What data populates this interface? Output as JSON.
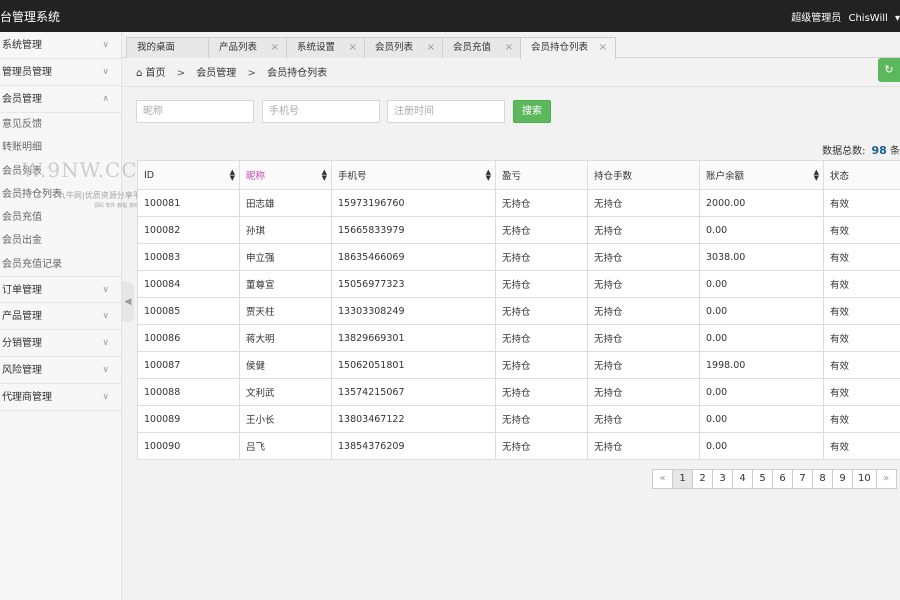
{
  "app": {
    "title": "台管理系统"
  },
  "user": {
    "role": "超级管理员",
    "name": "ChisWill",
    "caret": "▾"
  },
  "sidebar": {
    "items": [
      {
        "label": "系统管理",
        "icon": "chevron-down"
      },
      {
        "label": "管理员管理",
        "icon": "chevron-down"
      },
      {
        "label": "会员管理",
        "icon": "chevron-up",
        "children": [
          "意见反馈",
          "转账明细",
          "会员列表",
          "会员持仓列表",
          "会员充值",
          "会员出金",
          "会员充值记录"
        ]
      },
      {
        "label": "订单管理",
        "icon": "chevron-down"
      },
      {
        "label": "产品管理",
        "icon": "chevron-down"
      },
      {
        "label": "分销管理",
        "icon": "chevron-down"
      },
      {
        "label": "风险管理",
        "icon": "chevron-down"
      },
      {
        "label": "代理商管理",
        "icon": "chevron-down"
      }
    ],
    "collapse_icon": "◀"
  },
  "watermark": {
    "big": "W.9NW.CC",
    "small": "九牛网|优质资源分享平台",
    "tiny": "源码 软件 教程 游戏"
  },
  "tabs": [
    {
      "label": "我的桌面"
    },
    {
      "label": "产品列表",
      "close": "×"
    },
    {
      "label": "系统设置",
      "close": "×"
    },
    {
      "label": "会员列表",
      "close": "×"
    },
    {
      "label": "会员充值",
      "close": "×"
    },
    {
      "label": "会员持仓列表",
      "close": "×",
      "active": true
    }
  ],
  "breadcrumb": {
    "home_icon": "home",
    "home": "首页",
    "sep": ">",
    "level1": "会员管理",
    "level2": "会员持仓列表"
  },
  "toolbar": {
    "refresh_icon": "refresh"
  },
  "search": {
    "nickname_placeholder": "昵称",
    "phone_placeholder": "手机号",
    "register_time_placeholder": "注册时间",
    "button_label": "搜索"
  },
  "summary": {
    "label": "数据总数:",
    "count": "98",
    "suffix": "条"
  },
  "table": {
    "columns": [
      "ID",
      "昵称",
      "手机号",
      "盈亏",
      "持仓手数",
      "账户余额",
      "状态"
    ],
    "rows": [
      [
        "100081",
        "田志雄",
        "15973196760",
        "无持仓",
        "无持仓",
        "2000.00",
        "有效"
      ],
      [
        "100082",
        "孙琪",
        "15665833979",
        "无持仓",
        "无持仓",
        "0.00",
        "有效"
      ],
      [
        "100083",
        "申立强",
        "18635466069",
        "无持仓",
        "无持仓",
        "3038.00",
        "有效"
      ],
      [
        "100084",
        "董尊宣",
        "15056977323",
        "无持仓",
        "无持仓",
        "0.00",
        "有效"
      ],
      [
        "100085",
        "贾天柱",
        "13303308249",
        "无持仓",
        "无持仓",
        "0.00",
        "有效"
      ],
      [
        "100086",
        "蒋大明",
        "13829669301",
        "无持仓",
        "无持仓",
        "0.00",
        "有效"
      ],
      [
        "100087",
        "侯健",
        "15062051801",
        "无持仓",
        "无持仓",
        "1998.00",
        "有效"
      ],
      [
        "100088",
        "文利武",
        "13574215067",
        "无持仓",
        "无持仓",
        "0.00",
        "有效"
      ],
      [
        "100089",
        "王小长",
        "13803467122",
        "无持仓",
        "无持仓",
        "0.00",
        "有效"
      ],
      [
        "100090",
        "吕飞",
        "13854376209",
        "无持仓",
        "无持仓",
        "0.00",
        "有效"
      ]
    ]
  },
  "pagination": {
    "prev": "«",
    "pages": [
      "1",
      "2",
      "3",
      "4",
      "5",
      "6",
      "7",
      "8",
      "9",
      "10"
    ],
    "current": "1",
    "next": "»"
  }
}
